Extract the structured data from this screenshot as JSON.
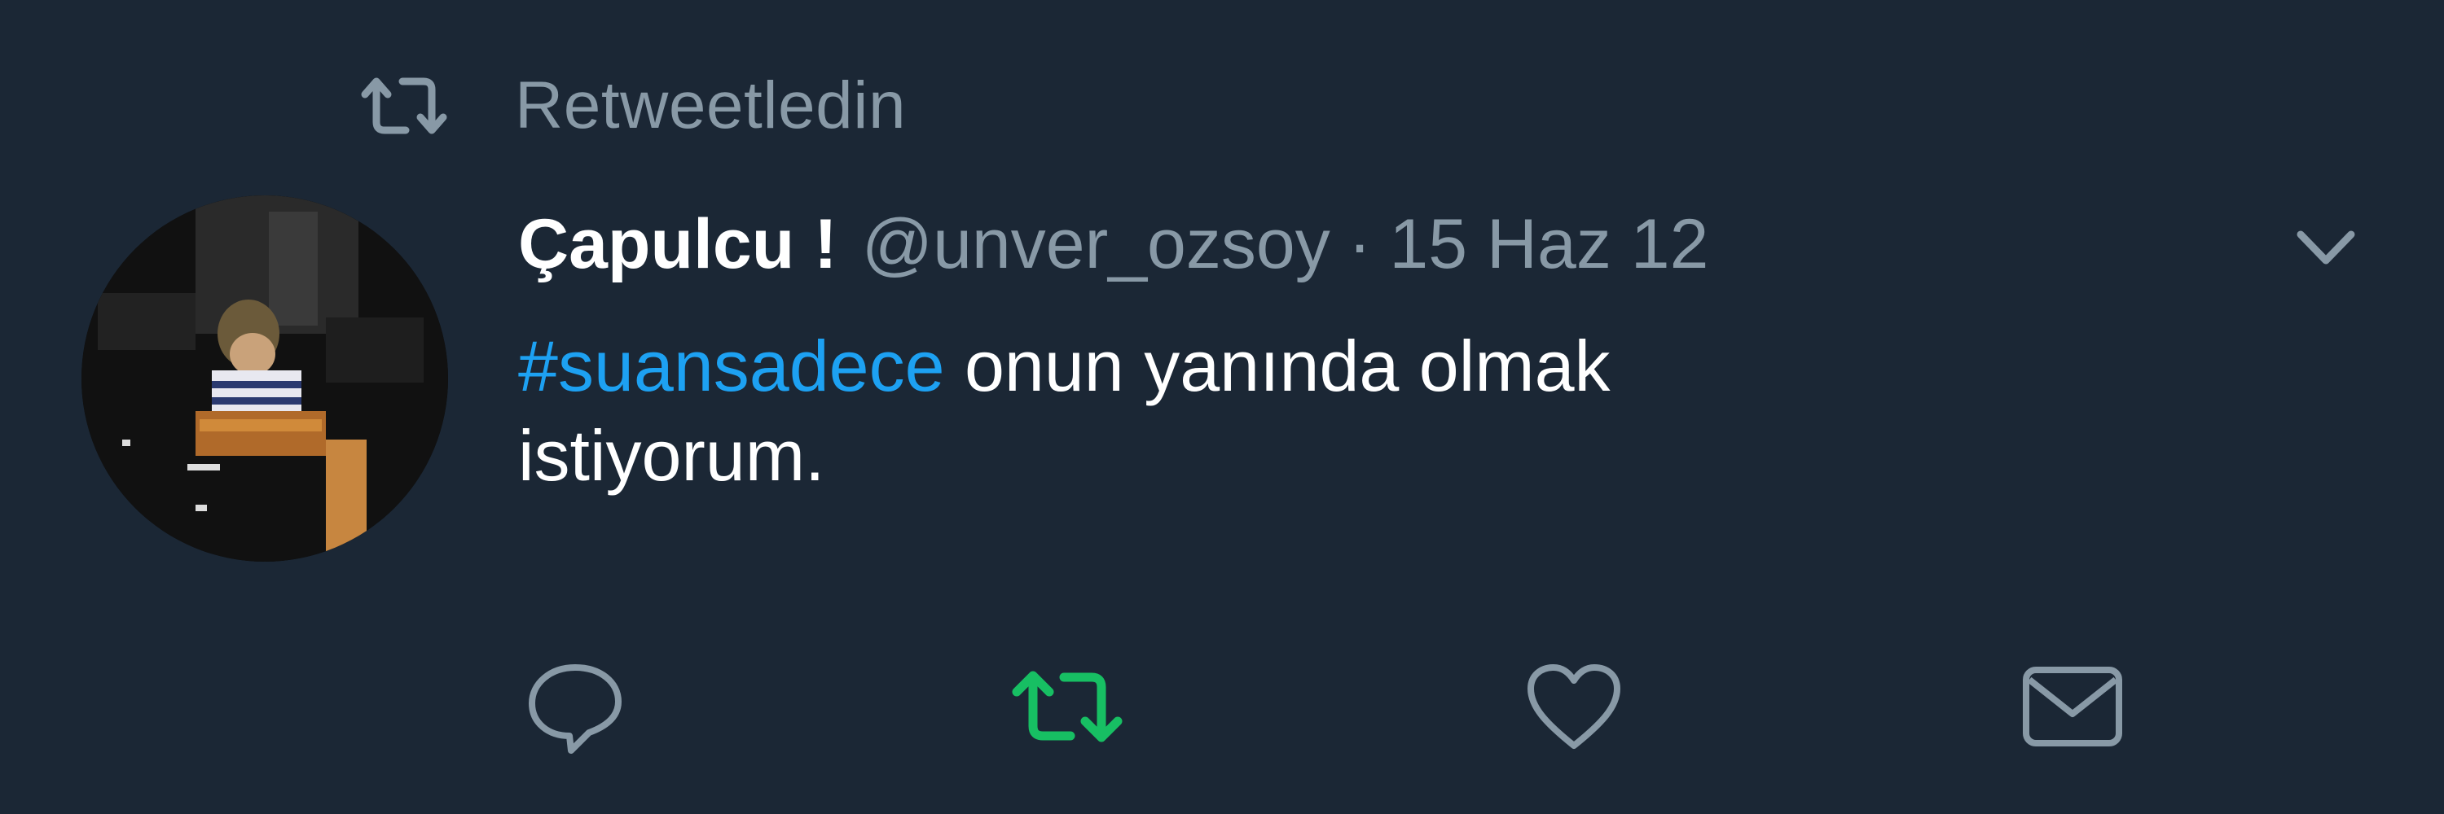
{
  "retweet_context": {
    "text": "Retweetledin",
    "icon": "retweet-icon"
  },
  "author": {
    "display_name": "Çapulcu !",
    "handle": "@unver_ozsoy",
    "separator": "·",
    "date": "15 Haz 12",
    "avatar": "profile-photo"
  },
  "tweet": {
    "hashtag": "#suansadece",
    "text_line1": " onun yanında olmak",
    "text_line2": "istiyorum."
  },
  "actions": [
    {
      "name": "reply",
      "icon": "reply-icon"
    },
    {
      "name": "retweet",
      "icon": "retweet-icon",
      "active": true
    },
    {
      "name": "like",
      "icon": "heart-icon"
    },
    {
      "name": "direct-message",
      "icon": "envelope-icon"
    }
  ],
  "colors": {
    "background": "#1b2735",
    "muted": "#8899a6",
    "text": "#ffffff",
    "link": "#1da1f2",
    "retweet_active": "#17bf63"
  }
}
